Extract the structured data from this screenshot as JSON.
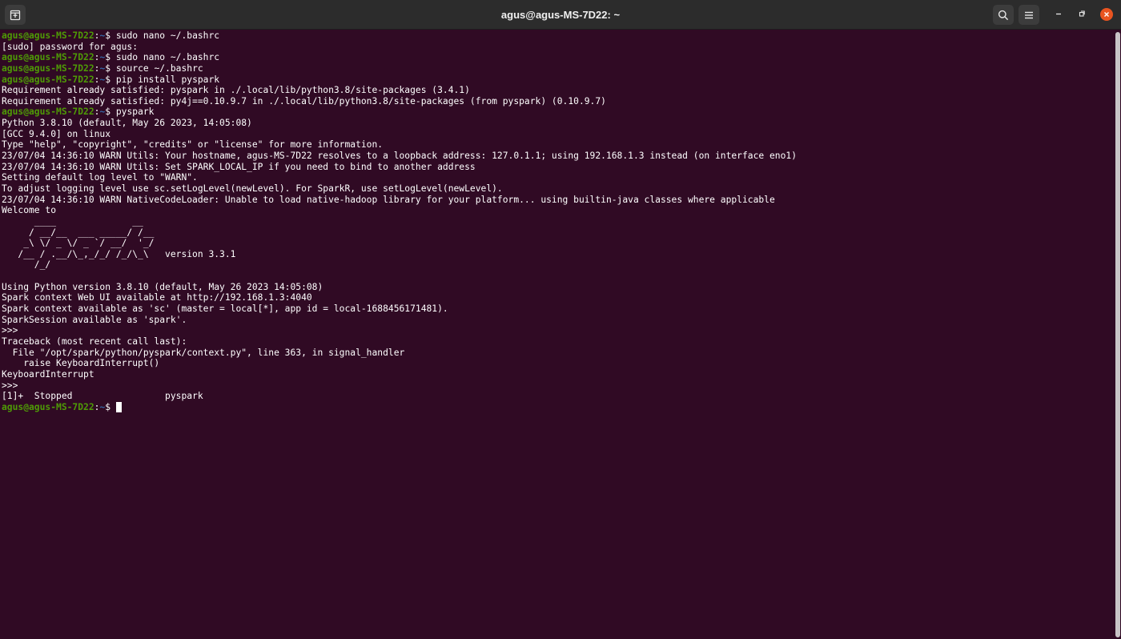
{
  "window": {
    "title": "agus@agus-MS-7D22: ~"
  },
  "titlebar": {
    "icons": {
      "new_tab": "new-tab-icon",
      "search": "search-icon",
      "menu": "hamburger-menu-icon",
      "minimize": "minimize-icon",
      "maximize": "restore-icon",
      "close": "close-icon"
    }
  },
  "colors": {
    "background": "#300a24",
    "prompt_user": "#4e9a06",
    "prompt_dir": "#3465a4",
    "text": "#ffffff",
    "close_button": "#e95420"
  },
  "terminal": {
    "prompt": {
      "user_host": "agus@agus-MS-7D22",
      "separator": ":",
      "dir": "~",
      "symbol": "$ "
    },
    "lines": [
      {
        "type": "prompt",
        "cmd": "sudo nano ~/.bashrc"
      },
      {
        "type": "out",
        "text": "[sudo] password for agus: "
      },
      {
        "type": "prompt",
        "cmd": "sudo nano ~/.bashrc"
      },
      {
        "type": "prompt",
        "cmd": "source ~/.bashrc"
      },
      {
        "type": "prompt",
        "cmd": "pip install pyspark"
      },
      {
        "type": "out",
        "text": "Requirement already satisfied: pyspark in ./.local/lib/python3.8/site-packages (3.4.1)"
      },
      {
        "type": "out",
        "text": "Requirement already satisfied: py4j==0.10.9.7 in ./.local/lib/python3.8/site-packages (from pyspark) (0.10.9.7)"
      },
      {
        "type": "prompt",
        "cmd": "pyspark"
      },
      {
        "type": "out",
        "text": "Python 3.8.10 (default, May 26 2023, 14:05:08) "
      },
      {
        "type": "out",
        "text": "[GCC 9.4.0] on linux"
      },
      {
        "type": "out",
        "text": "Type \"help\", \"copyright\", \"credits\" or \"license\" for more information."
      },
      {
        "type": "out",
        "text": "23/07/04 14:36:10 WARN Utils: Your hostname, agus-MS-7D22 resolves to a loopback address: 127.0.1.1; using 192.168.1.3 instead (on interface eno1)"
      },
      {
        "type": "out",
        "text": "23/07/04 14:36:10 WARN Utils: Set SPARK_LOCAL_IP if you need to bind to another address"
      },
      {
        "type": "out",
        "text": "Setting default log level to \"WARN\"."
      },
      {
        "type": "out",
        "text": "To adjust logging level use sc.setLogLevel(newLevel). For SparkR, use setLogLevel(newLevel)."
      },
      {
        "type": "out",
        "text": "23/07/04 14:36:10 WARN NativeCodeLoader: Unable to load native-hadoop library for your platform... using builtin-java classes where applicable"
      },
      {
        "type": "out",
        "text": "Welcome to"
      },
      {
        "type": "out",
        "text": "      ____              __"
      },
      {
        "type": "out",
        "text": "     / __/__  ___ _____/ /__"
      },
      {
        "type": "out",
        "text": "    _\\ \\/ _ \\/ _ `/ __/  '_/"
      },
      {
        "type": "out",
        "text": "   /__ / .__/\\_,_/_/ /_/\\_\\   version 3.3.1"
      },
      {
        "type": "out",
        "text": "      /_/"
      },
      {
        "type": "out",
        "text": ""
      },
      {
        "type": "out",
        "text": "Using Python version 3.8.10 (default, May 26 2023 14:05:08)"
      },
      {
        "type": "out",
        "text": "Spark context Web UI available at http://192.168.1.3:4040"
      },
      {
        "type": "out",
        "text": "Spark context available as 'sc' (master = local[*], app id = local-1688456171481)."
      },
      {
        "type": "out",
        "text": "SparkSession available as 'spark'."
      },
      {
        "type": "out",
        "text": ">>> "
      },
      {
        "type": "out",
        "text": "Traceback (most recent call last):"
      },
      {
        "type": "out",
        "text": "  File \"/opt/spark/python/pyspark/context.py\", line 363, in signal_handler"
      },
      {
        "type": "out",
        "text": "    raise KeyboardInterrupt()"
      },
      {
        "type": "out",
        "text": "KeyboardInterrupt"
      },
      {
        "type": "out",
        "text": ">>> "
      },
      {
        "type": "out",
        "text": "[1]+  Stopped                 pyspark"
      },
      {
        "type": "prompt_cursor",
        "cmd": ""
      }
    ]
  }
}
